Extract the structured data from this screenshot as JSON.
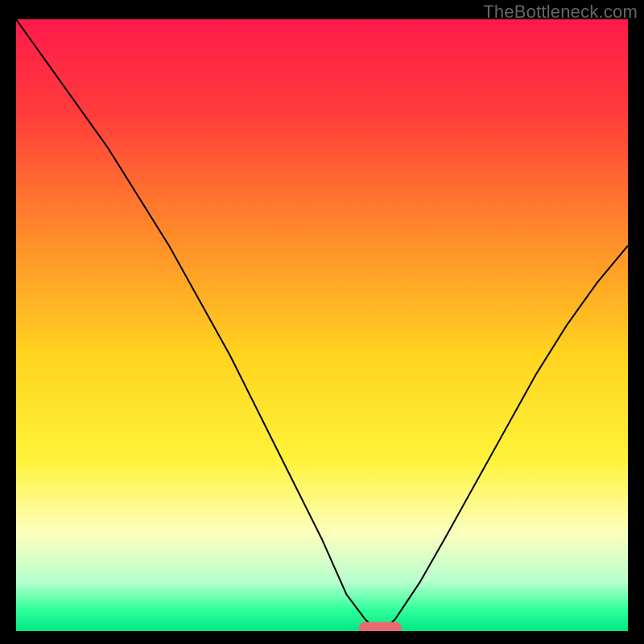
{
  "watermark": "TheBottleneck.com",
  "chart_data": {
    "type": "line",
    "title": "",
    "xlabel": "",
    "ylabel": "",
    "xlim": [
      0,
      100
    ],
    "ylim": [
      0,
      100
    ],
    "grid": false,
    "legend": false,
    "background_gradient": {
      "stops": [
        {
          "offset": 0.0,
          "color": "#ff1a4b"
        },
        {
          "offset": 0.15,
          "color": "#ff3b3b"
        },
        {
          "offset": 0.35,
          "color": "#ff8a2a"
        },
        {
          "offset": 0.55,
          "color": "#ffd41f"
        },
        {
          "offset": 0.72,
          "color": "#fff33a"
        },
        {
          "offset": 0.84,
          "color": "#fcffbe"
        },
        {
          "offset": 0.92,
          "color": "#b6ffce"
        },
        {
          "offset": 0.965,
          "color": "#2fff9a"
        },
        {
          "offset": 1.0,
          "color": "#00e884"
        }
      ]
    },
    "series": [
      {
        "name": "bottleneck-curve",
        "color": "#000000",
        "x": [
          0,
          5,
          10,
          15,
          20,
          25,
          30,
          35,
          40,
          45,
          50,
          54,
          57,
          59,
          60,
          62,
          66,
          70,
          75,
          80,
          85,
          90,
          95,
          100
        ],
        "y": [
          100,
          93,
          86,
          79,
          71,
          63,
          54,
          45,
          35,
          25,
          15,
          6,
          2,
          0,
          0,
          2,
          8,
          15,
          24,
          33,
          42,
          50,
          57,
          63
        ]
      }
    ],
    "marker": {
      "name": "sweet-spot-marker",
      "color": "#e96a6f",
      "x_start": 56,
      "x_end": 63,
      "y": 0.5,
      "height": 2
    }
  }
}
